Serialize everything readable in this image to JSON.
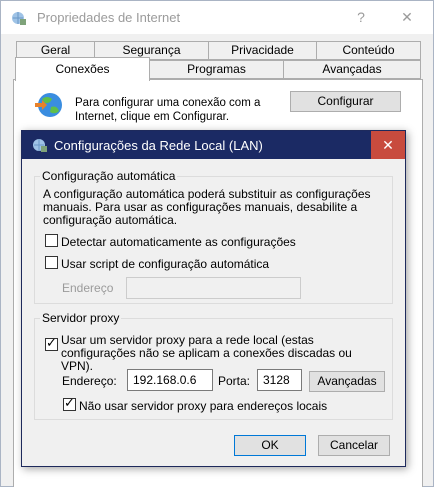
{
  "window": {
    "title": "Propriedades de Internet",
    "help_glyph": "?",
    "close_glyph": "✕"
  },
  "tabs_row1": [
    "Geral",
    "Segurança",
    "Privacidade",
    "Conteúdo"
  ],
  "tabs_row2": [
    "Conexões",
    "Programas",
    "Avançadas"
  ],
  "connections": {
    "setup_text": "Para configurar uma conexão com a Internet, clique em Configurar.",
    "setup_button": "Configurar"
  },
  "lan_dialog": {
    "title": "Configurações da Rede Local (LAN)",
    "close_glyph": "✕",
    "auto_config": {
      "legend": "Configuração automática",
      "description": "A configuração automática poderá substituir as configurações manuais. Para usar as configurações manuais, desabilite a configuração automática.",
      "auto_detect_label": "Detectar automaticamente as configurações",
      "auto_detect_checked": false,
      "use_script_label": "Usar script de configuração automática",
      "use_script_checked": false,
      "address_label": "Endereço",
      "address_value": ""
    },
    "proxy": {
      "legend": "Servidor proxy",
      "use_proxy_label": "Usar um servidor proxy para a rede local (estas configurações não se aplicam a conexões discadas ou VPN).",
      "use_proxy_checked": true,
      "address_label": "Endereço:",
      "address_value": "192.168.0.6",
      "port_label": "Porta:",
      "port_value": "3128",
      "advanced_button": "Avançadas",
      "bypass_local_label": "Não usar servidor proxy para endereços locais",
      "bypass_local_checked": true
    },
    "ok_button": "OK",
    "cancel_button": "Cancelar"
  },
  "colors": {
    "lan_titlebar": "#1b2a64",
    "close_button": "#c84b3e",
    "ok_border": "#0078d7"
  }
}
